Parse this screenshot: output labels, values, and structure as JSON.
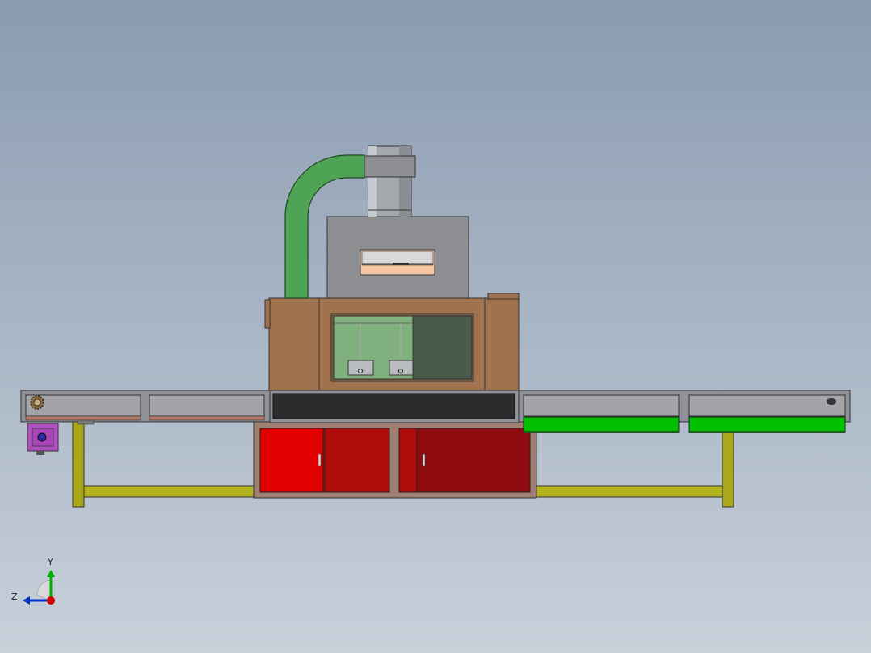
{
  "viewport": {
    "background_top": "#8a9bb0",
    "background_bottom": "#c8d0da"
  },
  "machine": {
    "parts": [
      "exhaust-duct",
      "exhaust-pipe",
      "lamp-housing",
      "inspection-window",
      "main-cabinet",
      "observation-window",
      "conveyor-belt",
      "input-conveyor",
      "output-conveyor",
      "drive-motor",
      "cabinet-doors",
      "support-frame"
    ],
    "colors": {
      "duct": "#4ea454",
      "steel": "#8d8f92",
      "cabinet": "#a0724e",
      "glass": "#7fb07e",
      "belt": "#2a2c2d",
      "conveyor": "#9a9ca1",
      "guide_green": "#00c000",
      "door_red_bright": "#e00000",
      "door_red_dark": "#a80a0a",
      "frame_yellow": "#a8a81a",
      "motor": "#b04fc1",
      "window_peach": "#f7c6a0"
    }
  },
  "triad": {
    "x_label": "",
    "y_label": "Y",
    "z_label": "Z",
    "x_color": "#d00000",
    "y_color": "#00b000",
    "z_color": "#0033cc"
  }
}
